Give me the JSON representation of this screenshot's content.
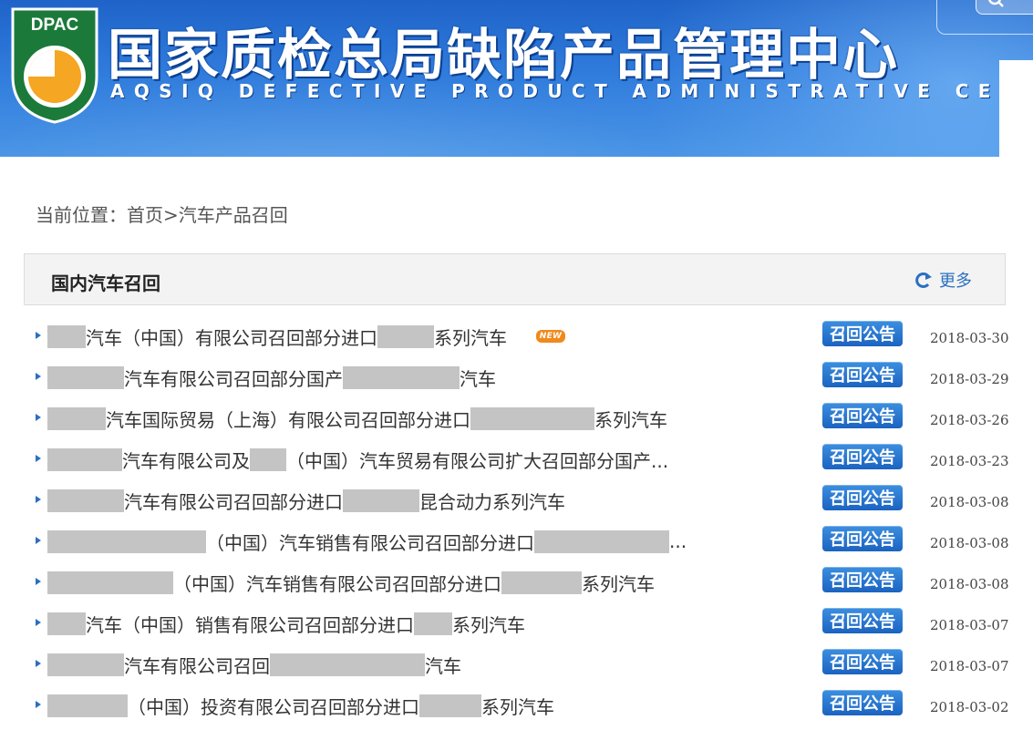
{
  "header": {
    "logo_text": "DPAC",
    "title": "国家质检总局缺陷产品管理中心",
    "subtitle": "AQSIQ DEFECTIVE PRODUCT ADMINISTRATIVE CENTER",
    "colors": {
      "banner": "#2f7bdc",
      "logo_green": "#1b7a3a",
      "logo_orange": "#f5a623"
    }
  },
  "breadcrumb": {
    "prefix": "当前位置：",
    "home": "首页",
    "separator": ">",
    "current": "汽车产品召回"
  },
  "section": {
    "title": "国内汽车召回",
    "more_label": "更多",
    "more_icon": "refresh-arrow-icon"
  },
  "recall_button_label": "召回公告",
  "new_badge_label": "NEW",
  "recalls": [
    {
      "segments": [
        {
          "redact": 42
        },
        {
          "text": "汽车（中国）有限公司召回部分进口"
        },
        {
          "redact": 62
        },
        {
          "text": "系列汽车"
        }
      ],
      "is_new": true,
      "date": "2018-03-30"
    },
    {
      "segments": [
        {
          "redact": 84
        },
        {
          "text": "汽车有限公司召回部分国产"
        },
        {
          "redact": 128
        },
        {
          "text": "汽车"
        }
      ],
      "is_new": false,
      "date": "2018-03-29"
    },
    {
      "segments": [
        {
          "redact": 64
        },
        {
          "text": "汽车国际贸易（上海）有限公司召回部分进口"
        },
        {
          "redact": 136
        },
        {
          "text": "系列汽车"
        }
      ],
      "is_new": false,
      "date": "2018-03-26"
    },
    {
      "segments": [
        {
          "redact": 82
        },
        {
          "text": "汽车有限公司及"
        },
        {
          "redact": 40
        },
        {
          "text": "（中国）汽车贸易有限公司扩大召回部分国产..."
        }
      ],
      "is_new": false,
      "date": "2018-03-23"
    },
    {
      "segments": [
        {
          "redact": 84
        },
        {
          "text": "汽车有限公司召回部分进口"
        },
        {
          "redact": 84
        },
        {
          "text": "昆合动力系列汽车"
        }
      ],
      "is_new": false,
      "date": "2018-03-08"
    },
    {
      "segments": [
        {
          "redact": 174
        },
        {
          "text": "（中国）汽车销售有限公司召回部分进口"
        },
        {
          "redact": 148
        },
        {
          "text": " ..."
        }
      ],
      "is_new": false,
      "date": "2018-03-08"
    },
    {
      "segments": [
        {
          "redact": 138
        },
        {
          "text": "（中国）汽车销售有限公司召回部分进口"
        },
        {
          "redact": 88
        },
        {
          "text": "系列汽车"
        }
      ],
      "is_new": false,
      "date": "2018-03-08"
    },
    {
      "segments": [
        {
          "redact": 42
        },
        {
          "text": "汽车（中国）销售有限公司召回部分进口"
        },
        {
          "redact": 42
        },
        {
          "text": "系列汽车"
        }
      ],
      "is_new": false,
      "date": "2018-03-07"
    },
    {
      "segments": [
        {
          "redact": 84
        },
        {
          "text": "汽车有限公司召回"
        },
        {
          "redact": 170
        },
        {
          "text": "汽车"
        }
      ],
      "is_new": false,
      "date": "2018-03-07"
    },
    {
      "segments": [
        {
          "redact": 88
        },
        {
          "text": "（中国）投资有限公司召回部分进口"
        },
        {
          "redact": 68
        },
        {
          "text": "系列汽车"
        }
      ],
      "is_new": false,
      "date": "2018-03-02"
    }
  ]
}
